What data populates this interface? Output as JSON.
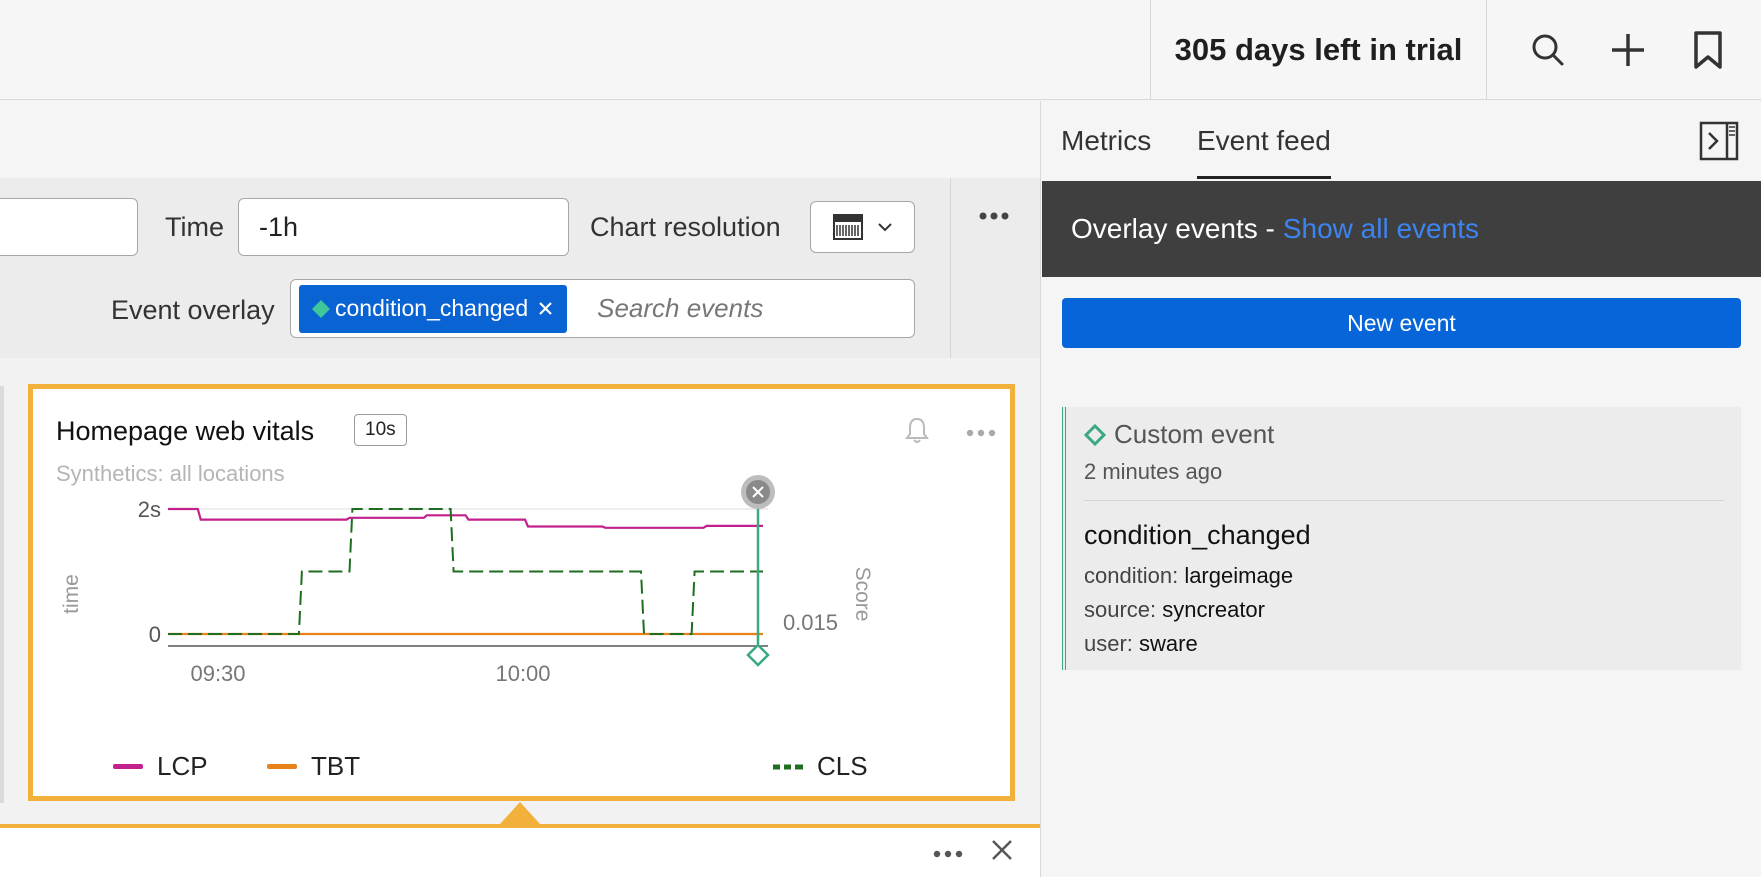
{
  "topbar": {
    "trial_text": "305 days left in trial",
    "icons": [
      "search-icon",
      "plus-icon",
      "bookmark-icon"
    ]
  },
  "controls": {
    "time_label": "Time",
    "time_value": "-1h",
    "resolution_label": "Chart resolution",
    "event_overlay_label": "Event overlay",
    "overlay_chip": "condition_changed",
    "search_placeholder": "Search events"
  },
  "chart": {
    "title": "Homepage web vitals",
    "resolution_badge": "10s",
    "subtitle": "Synthetics: all locations",
    "left_axis_label": "time",
    "right_axis_label": "Score",
    "right_tick": "0.015",
    "colors": {
      "LCP": "#c2208c",
      "TBT": "#e8821a",
      "CLS": "#1f6e1f",
      "event": "#3aa982",
      "card_border": "#f2b13b"
    }
  },
  "chart_data": {
    "type": "line",
    "ylabel": "time",
    "y2label": "Score",
    "x_ticks": [
      "09:30",
      "10:00"
    ],
    "y_ticks": [
      "0",
      "2s"
    ],
    "y2_ticks": [
      "0.015"
    ],
    "legend": [
      "LCP",
      "TBT",
      "CLS"
    ],
    "series": [
      {
        "name": "LCP",
        "points": [
          [
            0,
            2.0
          ],
          [
            0.05,
            2.0
          ],
          [
            0.055,
            1.83
          ],
          [
            0.3,
            1.83
          ],
          [
            0.305,
            1.86
          ],
          [
            0.38,
            1.86
          ],
          [
            0.385,
            1.86
          ],
          [
            0.43,
            1.86
          ],
          [
            0.435,
            1.9
          ],
          [
            0.5,
            1.9
          ],
          [
            0.505,
            1.83
          ],
          [
            0.6,
            1.83
          ],
          [
            0.605,
            1.72
          ],
          [
            0.73,
            1.72
          ],
          [
            0.735,
            1.7
          ],
          [
            0.9,
            1.7
          ],
          [
            0.905,
            1.73
          ],
          [
            1.0,
            1.73
          ]
        ]
      },
      {
        "name": "TBT",
        "points": [
          [
            0,
            0
          ],
          [
            1.0,
            0
          ]
        ]
      },
      {
        "name": "CLS",
        "points": [
          [
            0,
            0
          ],
          [
            0.22,
            0
          ],
          [
            0.225,
            1.0
          ],
          [
            0.305,
            1.0
          ],
          [
            0.31,
            2.0
          ],
          [
            0.475,
            2.0
          ],
          [
            0.48,
            1.0
          ],
          [
            0.795,
            1.0
          ],
          [
            0.8,
            0
          ],
          [
            0.88,
            0
          ],
          [
            0.885,
            1.0
          ],
          [
            1.0,
            1.0
          ]
        ]
      }
    ]
  },
  "right_panel": {
    "tabs": [
      "Metrics",
      "Event feed"
    ],
    "active_tab": 1,
    "overlay_title": "Overlay events -",
    "overlay_link": "Show all events",
    "new_event_label": "New event",
    "event": {
      "type": "Custom event",
      "time": "2 minutes ago",
      "name": "condition_changed",
      "fields": [
        {
          "key": "condition:",
          "value": "largeimage"
        },
        {
          "key": "source:",
          "value": "syncreator"
        },
        {
          "key": "user:",
          "value": "sware"
        }
      ]
    }
  }
}
